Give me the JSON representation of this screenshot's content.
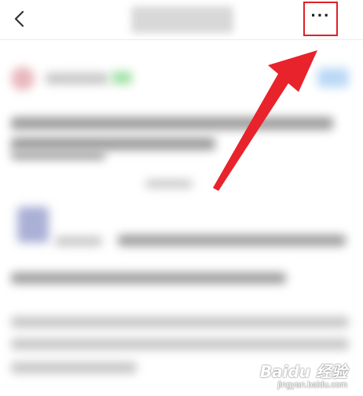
{
  "nav": {
    "back_icon": "‹",
    "more_icon": "···",
    "highlight_color": "#e11f26"
  },
  "annotation": {
    "arrow_color": "#e8232b"
  },
  "watermark": {
    "logo": "Baidu 经验",
    "sub": "jingyan.baidu.com"
  }
}
